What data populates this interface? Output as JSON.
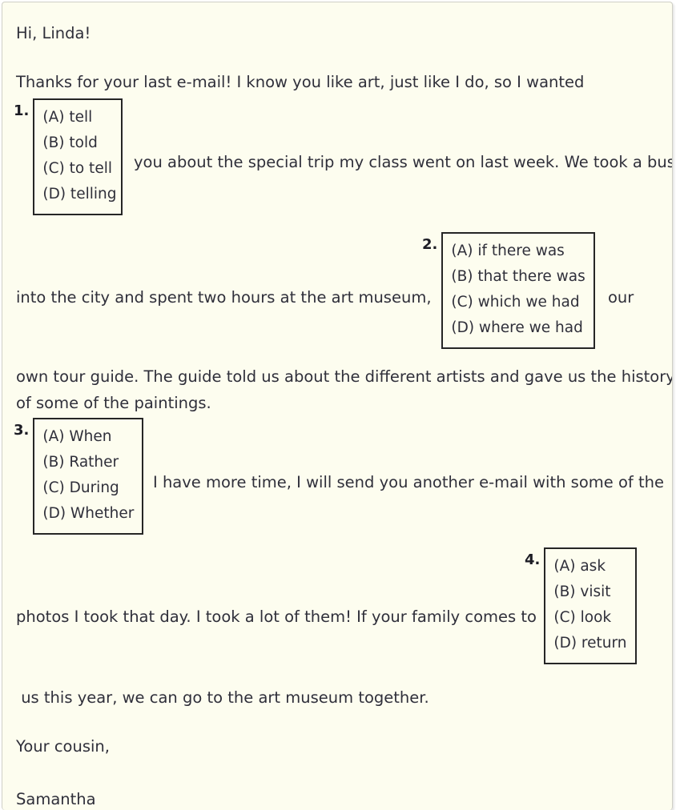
{
  "colors": {
    "page_background": "#fdfdef",
    "page_border": "#cfcfc6",
    "text": "#2f2f3a",
    "choice_box_border": "#262626",
    "question_number": "#1c1c24"
  },
  "passage": {
    "greeting": "Hi, Linda!",
    "paragraph1_line1": "Thanks for your last e-mail! I know you like art, just like I do, so I wanted",
    "paragraph1_line2": "you about the special trip my class went on last week. We took a bus",
    "paragraph1_line3": "into the city and spent two hours at the art museum,",
    "paragraph1_line4": "our",
    "paragraph1_line5": "own tour guide. The guide told us about the different artists and gave us the history",
    "paragraph1_line6": "of some of the paintings.",
    "paragraph2_line1": "I have more time, I will send you another e-mail with some of the",
    "paragraph2_line2": "photos I took that day. I took a lot of them! If your family comes to",
    "paragraph2_line3": " us this year, we can go to the art museum together.",
    "signoff": "Your cousin,",
    "signature": "Samantha"
  },
  "questions": [
    {
      "number": "1.",
      "choices": [
        "(A) tell",
        "(B) told",
        "(C) to tell",
        "(D) telling"
      ]
    },
    {
      "number": "2.",
      "choices": [
        "(A) if there was",
        "(B) that there was",
        "(C) which we had",
        "(D) where we had"
      ]
    },
    {
      "number": "3.",
      "choices": [
        "(A) When",
        "(B) Rather",
        "(C) During",
        "(D) Whether"
      ]
    },
    {
      "number": "4.",
      "choices": [
        "(A) ask",
        "(B) visit",
        "(C) look",
        "(D) return"
      ]
    }
  ]
}
